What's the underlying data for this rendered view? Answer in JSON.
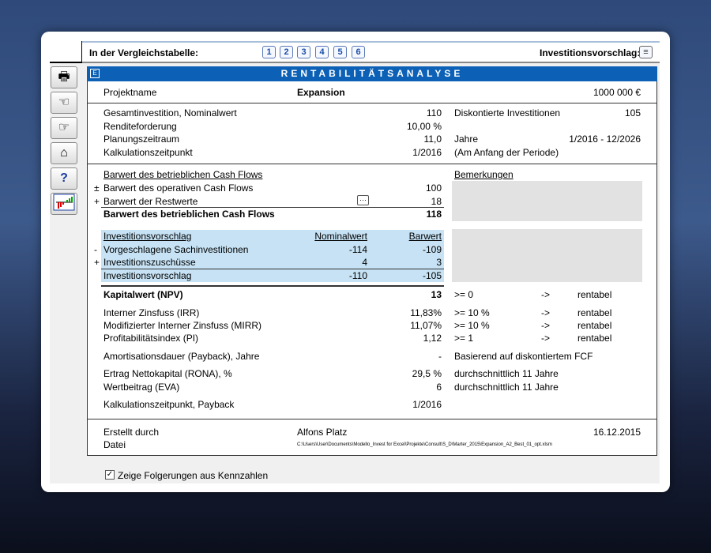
{
  "toolbar": {
    "compare_label": "In der Vergleichstabelle:",
    "compare_buttons": [
      "1",
      "2",
      "3",
      "4",
      "5",
      "6"
    ],
    "proposal_label": "Investitionsvorschlag:"
  },
  "title": "RENTABILITÄTSANALYSE",
  "project": {
    "label": "Projektname",
    "name": "Expansion",
    "amount": "1000 000 €"
  },
  "basics": [
    {
      "label": "Gesamtinvestition, Nominalwert",
      "value": "110",
      "rlabel": "Diskontierte Investitionen",
      "rvalue": "105"
    },
    {
      "label": "Renditeforderung",
      "value": "10,00 %",
      "rlabel": "",
      "rvalue": ""
    },
    {
      "label": "Planungszeitraum",
      "value": "11,0",
      "rlabel": "Jahre",
      "rvalue": "1/2016 - 12/2026"
    },
    {
      "label": "Kalkulationszeitpunkt",
      "value": "1/2016",
      "rlabel": "(Am Anfang der Periode)",
      "rvalue": ""
    }
  ],
  "cashflow": {
    "heading": "Barwert des betrieblichen Cash Flows",
    "remarks": "Bemerkungen",
    "rows": [
      {
        "sign": "±",
        "label": "Barwert des operativen Cash Flows",
        "value": "100"
      },
      {
        "sign": "+",
        "label": "Barwert der Restwerte",
        "value": "18"
      }
    ],
    "total_label": "Barwert des betrieblichen Cash Flows",
    "total_value": "118",
    "more": "···"
  },
  "proposal": {
    "heading": "Investitionsvorschlag",
    "col1": "Nominalwert",
    "col2": "Barwert",
    "rows": [
      {
        "sign": "-",
        "label": "Vorgeschlagene Sachinvestitionen",
        "nom": "-114",
        "bar": "-109"
      },
      {
        "sign": "+",
        "label": "Investitionszuschüsse",
        "nom": "4",
        "bar": "3"
      }
    ],
    "total_label": "Investitionsvorschlag",
    "total_nom": "-110",
    "total_bar": "-105"
  },
  "npv": {
    "label": "Kapitalwert (NPV)",
    "value": "13",
    "cond": ">= 0",
    "arrow": "->",
    "result": "rentabel"
  },
  "metrics": [
    {
      "label": "Interner Zinsfuss (IRR)",
      "value": "11,83%",
      "cond": ">= 10 %",
      "arrow": "->",
      "result": "rentabel"
    },
    {
      "label": "Modifizierter Interner Zinsfuss (MIRR)",
      "value": "11,07%",
      "cond": ">= 10 %",
      "arrow": "->",
      "result": "rentabel"
    },
    {
      "label": "Profitabilitätsindex (PI)",
      "value": "1,12",
      "cond": ">= 1",
      "arrow": "->",
      "result": "rentabel"
    }
  ],
  "payback": {
    "label": "Amortisationsdauer (Payback), Jahre",
    "value": "-",
    "note": "Basierend auf diskontiertem FCF"
  },
  "rona": {
    "label": "Ertrag Nettokapital (RONA),  %",
    "value": "29,5 %",
    "note": "durchschnittlich 11 Jahre"
  },
  "eva": {
    "label": "Wertbeitrag (EVA)",
    "value": "6",
    "note": "durchschnittlich 11 Jahre"
  },
  "calc_payback": {
    "label": "Kalkulationszeitpunkt, Payback",
    "value": "1/2016"
  },
  "footer": {
    "created_label": "Erstellt durch",
    "created_by": "Alfons Platz",
    "date": "16.12.2015",
    "file_label": "Datei",
    "file_path": "C:\\Users\\User\\Documents\\Modello_Invest for Excel\\Projekte\\Consult\\S_D\\Marter_2015\\Expansion_A2_Best_01_opt.xlsm"
  },
  "checkbox": {
    "label": "Zeige Folgerungen aus Kennzahlen",
    "checked": true
  }
}
